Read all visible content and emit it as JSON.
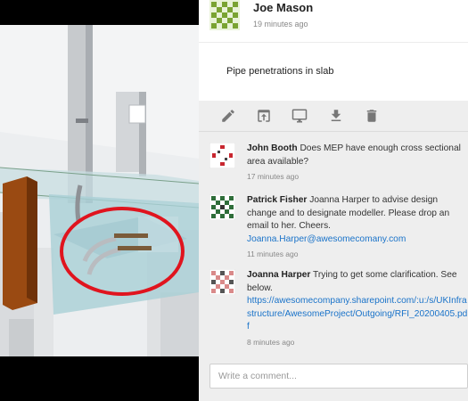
{
  "post": {
    "author": "Joe Mason",
    "time": "19 minutes ago",
    "text": "Pipe penetrations in slab"
  },
  "toolbar": {
    "icons": [
      "edit-icon",
      "share-upload-icon",
      "monitor-icon",
      "download-icon",
      "delete-icon"
    ]
  },
  "comments": [
    {
      "author": "John Booth",
      "text": "Does MEP have enough cross sectional area available?",
      "link": "",
      "time": "17 minutes ago"
    },
    {
      "author": "Patrick Fisher",
      "text": "Joanna Harper to advise design change and to designate modeller. Please drop an email to her. Cheers.",
      "link": "Joanna.Harper@awesomecomany.com",
      "time": "11 minutes ago"
    },
    {
      "author": "Joanna Harper",
      "text": "Trying to get some clarification. See below.",
      "link": "https://awesomecompany.sharepoint.com/:u:/s/UKInfrastructure/AwesomeProject/Outgoing/RFI_20200405.pdf",
      "time": "8 minutes ago"
    }
  ],
  "comment_input": {
    "placeholder": "Write a comment..."
  },
  "colors": {
    "link": "#1a73c9",
    "markup_circle": "#e0141e",
    "slab_glass": "#a9cfd6",
    "beam_orange": "#9a4a12"
  }
}
